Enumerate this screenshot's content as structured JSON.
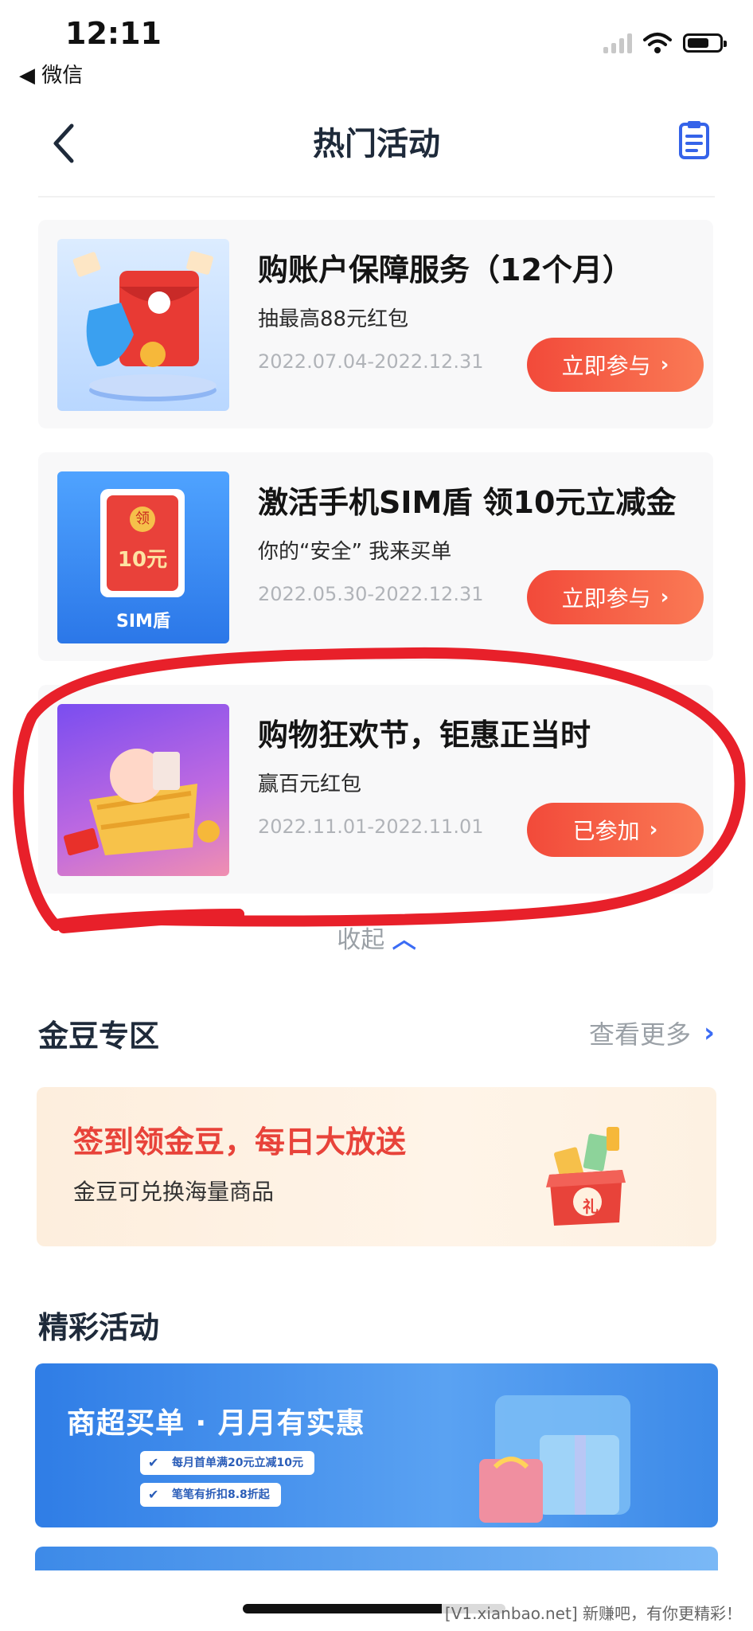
{
  "status_bar": {
    "time": "12:11",
    "back_app": "◀ 微信"
  },
  "nav": {
    "title": "热门活动"
  },
  "activities": [
    {
      "title": "购账户保障服务（12个月）",
      "subtitle": "抽最高88元红包",
      "date": "2022.07.04-2022.12.31",
      "button": "立即参与"
    },
    {
      "title": "激活手机SIM盾 领10元立减金",
      "subtitle": "你的“安全” 我来买单",
      "date": "2022.05.30-2022.12.31",
      "button": "立即参与",
      "thumb_badge": "领",
      "thumb_amount": "10元",
      "thumb_brand": "SIM盾"
    },
    {
      "title": "购物狂欢节，钜惠正当时",
      "subtitle": "赢百元红包",
      "date": "2022.11.01-2022.11.01",
      "button": "已参加"
    }
  ],
  "collapse_label": "收起",
  "gold_bean": {
    "section_title": "金豆专区",
    "more_label": "查看更多",
    "banner_title": "签到领金豆，每日大放送",
    "banner_subtitle": "金豆可兑换海量商品",
    "gift_char": "礼"
  },
  "featured": {
    "section_title": "精彩活动",
    "banner_title": "商超买单 · 月月有实惠",
    "tags": [
      "每月首单满20元立减10元",
      "笔笔有折扣8.8折起"
    ]
  },
  "watermark": "[V1.xianbao.net] 新赚吧，有你更精彩！",
  "colors": {
    "accent_red": "#f24a3a",
    "annotation_red": "#e8202a",
    "link_blue": "#3b6cf5"
  },
  "icons": {
    "back": "chevron-left-icon",
    "record": "clipboard-icon",
    "more": "chevron-right-icon",
    "collapse": "chevron-up-icon"
  }
}
